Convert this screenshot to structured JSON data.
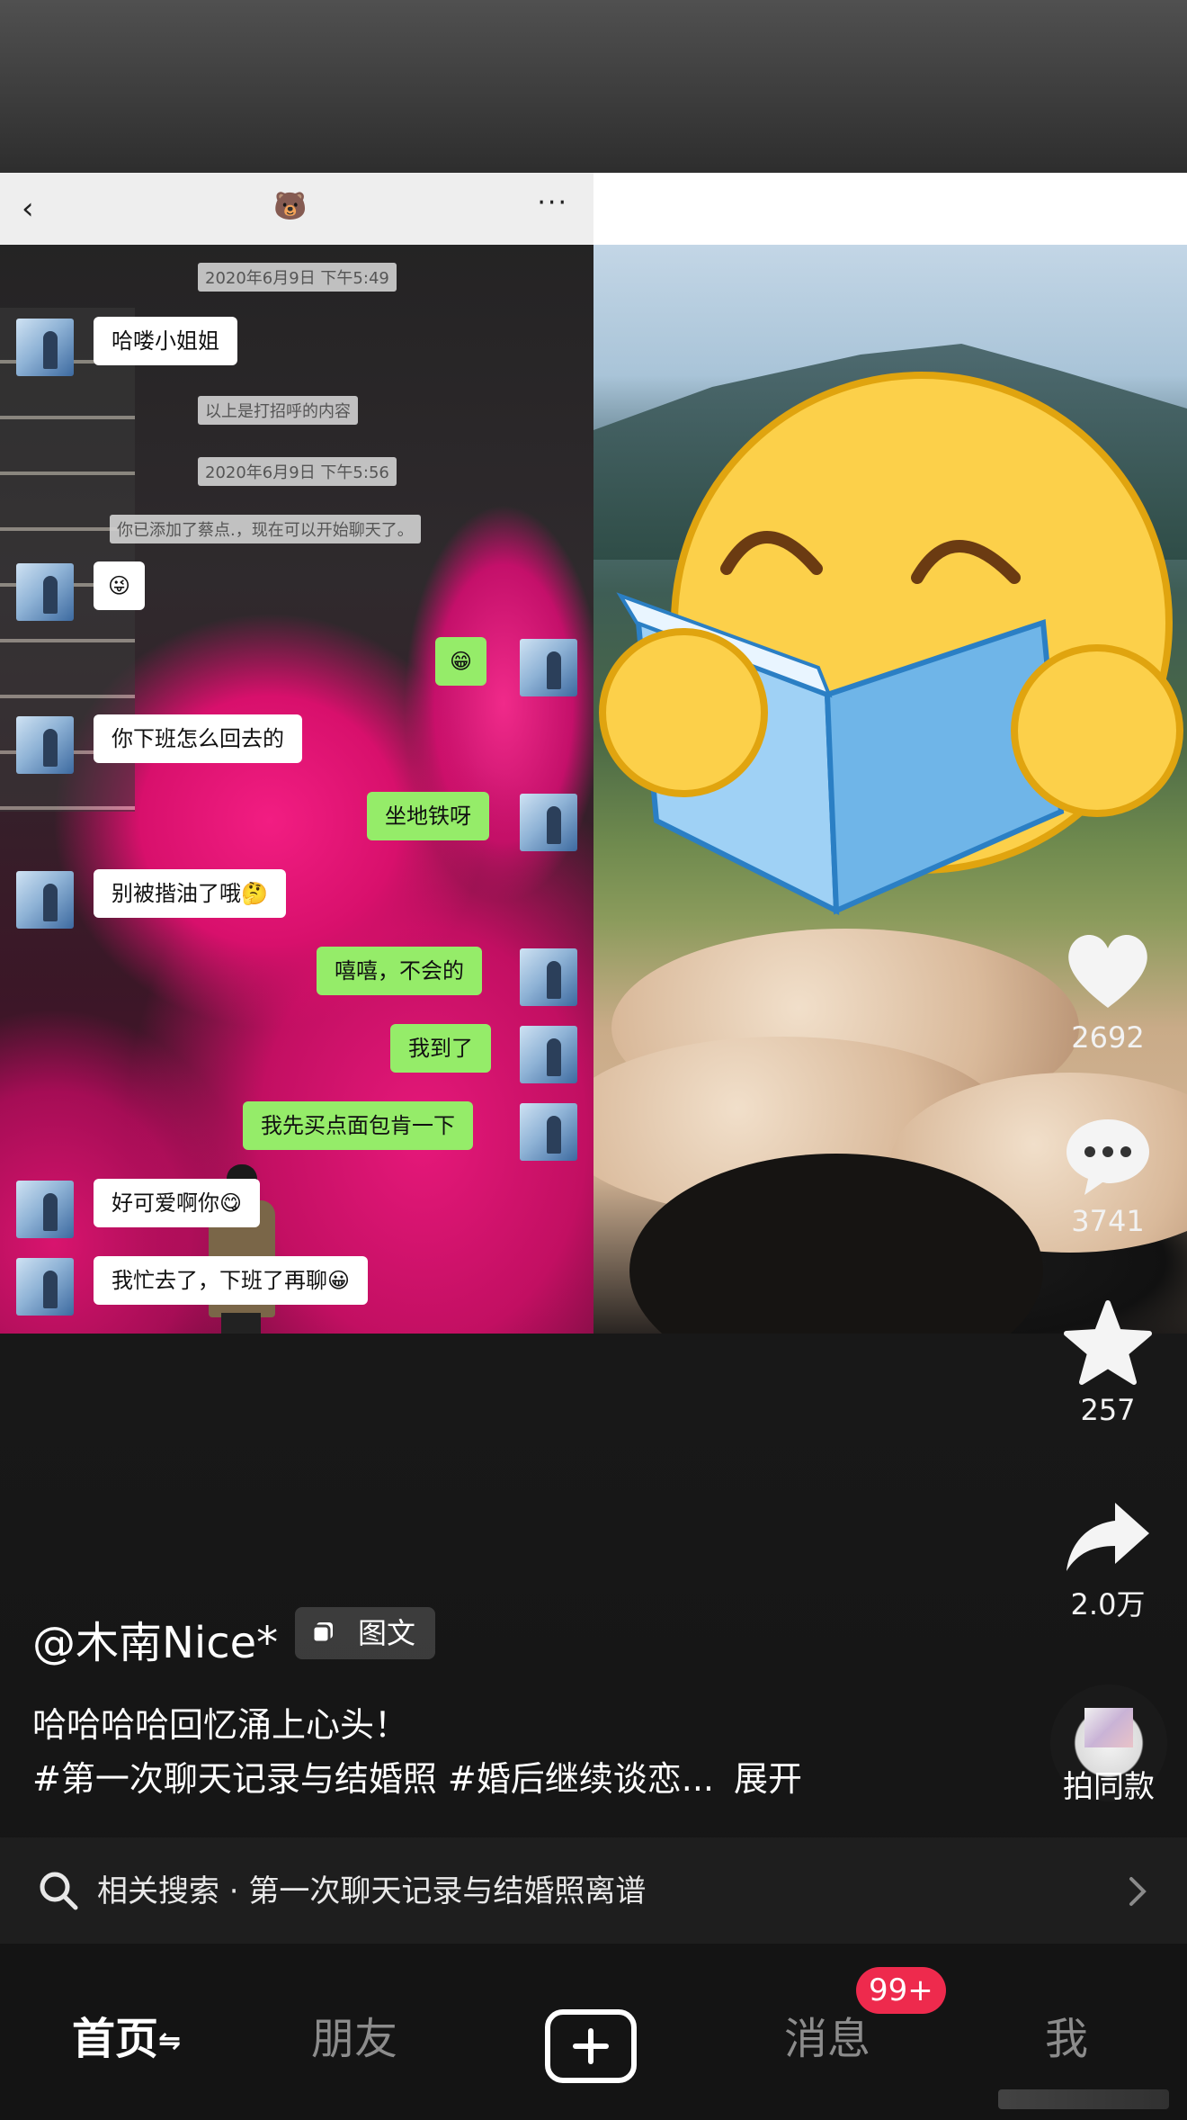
{
  "chat": {
    "timestamps": [
      "2020年6月9日 下午5:49",
      "2020年6月9日 下午5:56"
    ],
    "system_notes": [
      "以上是打招呼的内容",
      "你已添加了蔡点.，现在可以开始聊天了。"
    ],
    "title_icon": "🐻",
    "messages": [
      {
        "side": "left",
        "text": "哈喽小姐姐"
      },
      {
        "side": "left",
        "text": "😜"
      },
      {
        "side": "right",
        "text": "😁"
      },
      {
        "side": "left",
        "text": "你下班怎么回去的"
      },
      {
        "side": "right",
        "text": "坐地铁呀"
      },
      {
        "side": "left",
        "text": "别被揩油了哦🤔"
      },
      {
        "side": "right",
        "text": "嘻嘻，不会的"
      },
      {
        "side": "right",
        "text": "我到了"
      },
      {
        "side": "right",
        "text": "我先买点面包肯一下"
      },
      {
        "side": "left",
        "text": "好可爱啊你😋"
      },
      {
        "side": "left",
        "text": "我忙去了，下班了再聊😀"
      }
    ]
  },
  "actions": {
    "likes": "2692",
    "comments": "3741",
    "favorites": "257",
    "shares": "2.0万",
    "same_style_label": "拍同款"
  },
  "post": {
    "author": "@木南Nice*",
    "type_tag": "图文",
    "caption_line1": "哈哈哈哈回忆涌上心头！",
    "caption_line2": "#第一次聊天记录与结婚照 #婚后继续谈恋...",
    "expand_label": "展开"
  },
  "related_search": {
    "prefix": "相关搜索 · ",
    "query": "第一次聊天记录与结婚照离谱"
  },
  "nav": {
    "home": "首页",
    "home_switch_icon": "⇋",
    "friends": "朋友",
    "messages": "消息",
    "messages_badge": "99+",
    "me": "我"
  },
  "colors": {
    "sent_bubble": "#95ec69",
    "received_bubble": "#ffffff",
    "badge": "#ee2a4d",
    "bear_pink": "#e6187a"
  },
  "icons": [
    "back-icon",
    "more-icon",
    "heart-icon",
    "comment-icon",
    "star-icon",
    "share-icon",
    "search-icon",
    "chevron-right-icon",
    "plus-icon"
  ]
}
